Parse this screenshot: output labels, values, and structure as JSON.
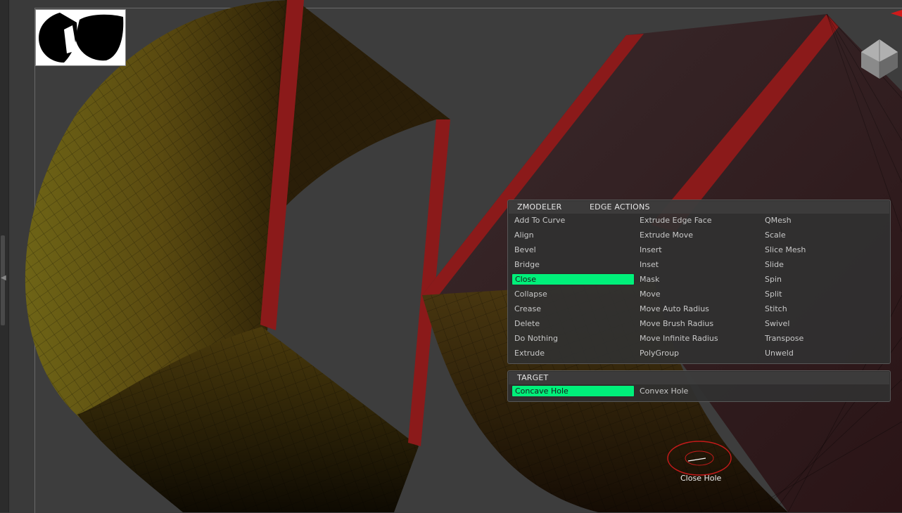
{
  "zmodeler_panel": {
    "title": "ZMODELER",
    "subtitle": "EDGE ACTIONS",
    "columns": [
      [
        "Add To Curve",
        "Align",
        "Bevel",
        "Bridge",
        "Close",
        "Collapse",
        "Crease",
        "Delete",
        "Do Nothing",
        "Extrude"
      ],
      [
        "Extrude Edge Face",
        "Extrude Move",
        "Insert",
        "Inset",
        "Mask",
        "Move",
        "Move Auto Radius",
        "Move Brush Radius",
        "Move Infinite Radius",
        "PolyGroup"
      ],
      [
        "QMesh",
        "Scale",
        "Slice Mesh",
        "Slide",
        "Spin",
        "Split",
        "Stitch",
        "Swivel",
        "Transpose",
        "Unweld"
      ]
    ],
    "selected": "Close"
  },
  "target_panel": {
    "title": "TARGET",
    "items": [
      "Concave Hole",
      "Convex Hole"
    ],
    "selected": "Concave Hole"
  },
  "cursor_caption": "Close Hole",
  "colors": {
    "accent": "#00f07a",
    "edge_highlight": "#8b1a1a",
    "mesh_gold": "#6b5a12",
    "background": "#3a3a3a"
  }
}
